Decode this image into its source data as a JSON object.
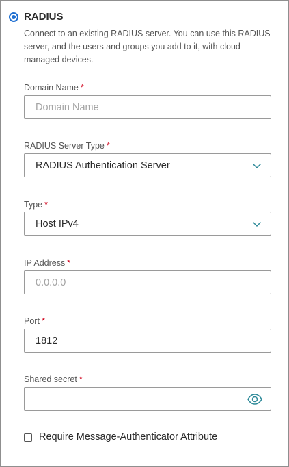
{
  "radio": {
    "label": "RADIUS",
    "selected": true
  },
  "description": "Connect to an existing RADIUS server. You can use this RADIUS server, and the users and groups you add to it, with cloud-managed devices.",
  "required_marker": "*",
  "fields": {
    "domain_name": {
      "label": "Domain Name",
      "value": "",
      "placeholder": "Domain Name"
    },
    "server_type": {
      "label": "RADIUS Server Type",
      "value": "RADIUS Authentication Server",
      "icon": "chevron-down-icon"
    },
    "type": {
      "label": "Type",
      "value": "Host IPv4",
      "icon": "chevron-down-icon"
    },
    "ip_address": {
      "label": "IP Address",
      "value": "",
      "placeholder": "0.0.0.0"
    },
    "port": {
      "label": "Port",
      "value": "1812"
    },
    "shared_secret": {
      "label": "Shared secret",
      "value": "",
      "icon": "eye-icon"
    }
  },
  "checkbox": {
    "label": "Require Message-Authenticator Attribute",
    "checked": false
  },
  "colors": {
    "accent": "#1f6fd1",
    "required": "#d0021b",
    "border": "#9a9a9a",
    "icon": "#2e8a99"
  }
}
